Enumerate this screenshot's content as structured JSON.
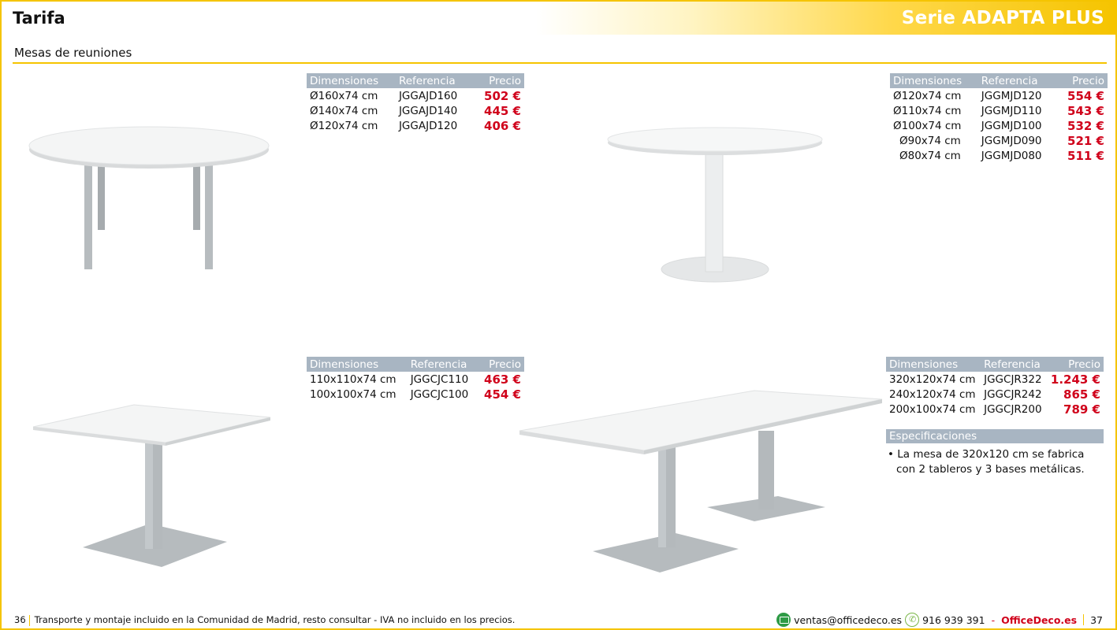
{
  "header": {
    "title": "Tarifa",
    "series": "Serie ADAPTA PLUS"
  },
  "section": {
    "title": "Mesas de reuniones"
  },
  "columns": {
    "dim": "Dimensiones",
    "ref": "Referencia",
    "price": "Precio"
  },
  "tables": [
    {
      "rows": [
        {
          "dim": "Ø160x74 cm",
          "ref": "JGGAJD160",
          "price": "502 €"
        },
        {
          "dim": "Ø140x74 cm",
          "ref": "JGGAJD140",
          "price": "445 €"
        },
        {
          "dim": "Ø120x74 cm",
          "ref": "JGGAJD120",
          "price": "406 €"
        }
      ]
    },
    {
      "rows": [
        {
          "dim": "Ø120x74 cm",
          "ref": "JGGMJD120",
          "price": "554 €"
        },
        {
          "dim": "Ø110x74 cm",
          "ref": "JGGMJD110",
          "price": "543 €"
        },
        {
          "dim": "Ø100x74 cm",
          "ref": "JGGMJD100",
          "price": "532 €"
        },
        {
          "dim": "Ø90x74 cm",
          "ref": "JGGMJD090",
          "price": "521 €"
        },
        {
          "dim": "Ø80x74 cm",
          "ref": "JGGMJD080",
          "price": "511 €"
        }
      ]
    },
    {
      "rows": [
        {
          "dim": "110x110x74 cm",
          "ref": "JGGCJC110",
          "price": "463 €"
        },
        {
          "dim": "100x100x74 cm",
          "ref": "JGGCJC100",
          "price": "454 €"
        }
      ]
    },
    {
      "rows": [
        {
          "dim": "320x120x74 cm",
          "ref": "JGGCJR322",
          "price": "1.243 €"
        },
        {
          "dim": "240x120x74 cm",
          "ref": "JGGCJR242",
          "price": "865 €"
        },
        {
          "dim": "200x100x74 cm",
          "ref": "JGGCJR200",
          "price": "789 €"
        }
      ]
    }
  ],
  "specs": {
    "title": "Especificaciones",
    "text": "• La mesa de 320x120 cm se fabrica con 2 tableros y 3 bases metálicas."
  },
  "footer": {
    "page_left": "36",
    "note": "Transporte y montaje incluido en la Comunidad de Madrid, resto consultar - IVA no incluido en los precios.",
    "email": "ventas@officedeco.es",
    "phone": "916 939 391",
    "dash": "-",
    "brand": "OfficeDeco.es",
    "page_right": "37"
  },
  "colors": {
    "accent": "#f5c400",
    "price": "#d0021b",
    "table_header": "#a8b5c2"
  }
}
